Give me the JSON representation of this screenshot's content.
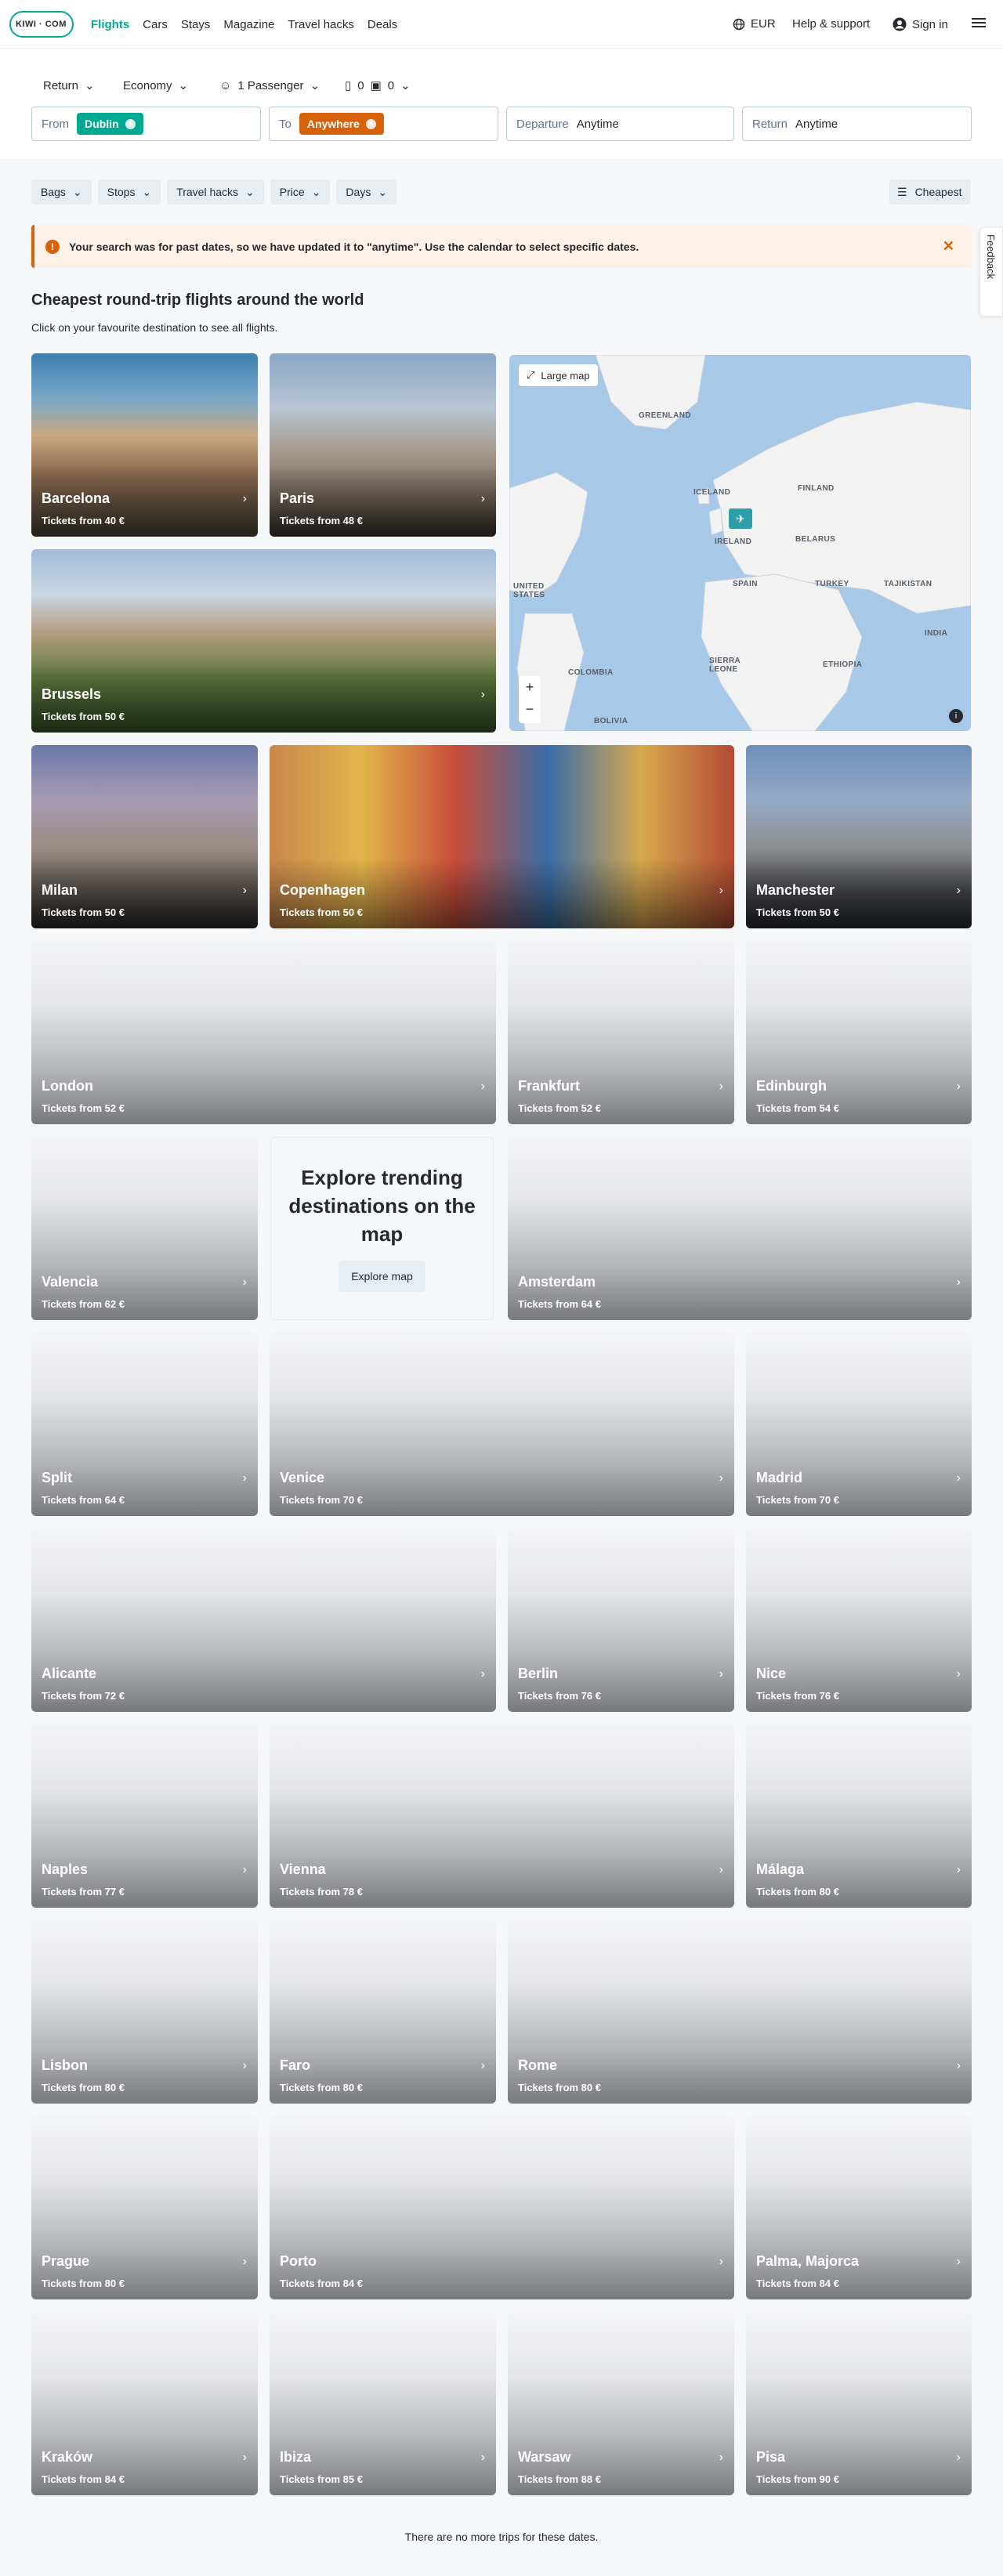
{
  "header": {
    "logo": "KIWI · COM",
    "nav": [
      "Flights",
      "Cars",
      "Stays",
      "Magazine",
      "Travel hacks",
      "Deals"
    ],
    "currency": "EUR",
    "help": "Help & support",
    "signin": "Sign in"
  },
  "search": {
    "trip_type": "Return",
    "cabin": "Economy",
    "passengers": "1 Passenger",
    "cabin_bags": "0",
    "checked_bags": "0",
    "from_label": "From",
    "from_value": "Dublin",
    "to_label": "To",
    "to_value": "Anywhere",
    "departure_label": "Departure",
    "departure_value": "Anytime",
    "return_label": "Return",
    "return_value": "Anytime"
  },
  "filters": [
    "Bags",
    "Stops",
    "Travel hacks",
    "Price",
    "Days"
  ],
  "sort": "Cheapest",
  "alert": "Your search was for past dates, so we have updated it to \"anytime\". Use the calendar to select specific dates.",
  "feedback": "Feedback",
  "page": {
    "title": "Cheapest round-trip flights around the world",
    "subtitle": "Click on your favourite destination to see all flights."
  },
  "map": {
    "button": "Large map",
    "labels": [
      "GREENLAND",
      "ICELAND",
      "FINLAND",
      "IRELAND",
      "BELARUS",
      "UNITED STATES",
      "SPAIN",
      "TURKEY",
      "TAJIKISTAN",
      "INDIA",
      "COLOMBIA",
      "SIERRA LEONE",
      "ETHIOPIA",
      "BOLIVIA"
    ]
  },
  "trending": {
    "title": "Explore trending destinations on the map",
    "button": "Explore map"
  },
  "destinations": [
    {
      "name": "Barcelona",
      "price": "Tickets from 40 €"
    },
    {
      "name": "Paris",
      "price": "Tickets from 48 €"
    },
    {
      "name": "Brussels",
      "price": "Tickets from 50 €"
    },
    {
      "name": "Milan",
      "price": "Tickets from 50 €"
    },
    {
      "name": "Copenhagen",
      "price": "Tickets from 50 €"
    },
    {
      "name": "Manchester",
      "price": "Tickets from 50 €"
    },
    {
      "name": "London",
      "price": "Tickets from 52 €"
    },
    {
      "name": "Frankfurt",
      "price": "Tickets from 52 €"
    },
    {
      "name": "Edinburgh",
      "price": "Tickets from 54 €"
    },
    {
      "name": "Valencia",
      "price": "Tickets from 62 €"
    },
    {
      "name": "Amsterdam",
      "price": "Tickets from 64 €"
    },
    {
      "name": "Split",
      "price": "Tickets from 64 €"
    },
    {
      "name": "Venice",
      "price": "Tickets from 70 €"
    },
    {
      "name": "Madrid",
      "price": "Tickets from 70 €"
    },
    {
      "name": "Alicante",
      "price": "Tickets from 72 €"
    },
    {
      "name": "Berlin",
      "price": "Tickets from 76 €"
    },
    {
      "name": "Nice",
      "price": "Tickets from 76 €"
    },
    {
      "name": "Naples",
      "price": "Tickets from 77 €"
    },
    {
      "name": "Vienna",
      "price": "Tickets from 78 €"
    },
    {
      "name": "Málaga",
      "price": "Tickets from 80 €"
    },
    {
      "name": "Lisbon",
      "price": "Tickets from 80 €"
    },
    {
      "name": "Faro",
      "price": "Tickets from 80 €"
    },
    {
      "name": "Rome",
      "price": "Tickets from 80 €"
    },
    {
      "name": "Prague",
      "price": "Tickets from 80 €"
    },
    {
      "name": "Porto",
      "price": "Tickets from 84 €"
    },
    {
      "name": "Palma, Majorca",
      "price": "Tickets from 84 €"
    },
    {
      "name": "Kraków",
      "price": "Tickets from 84 €"
    },
    {
      "name": "Ibiza",
      "price": "Tickets from 85 €"
    },
    {
      "name": "Warsaw",
      "price": "Tickets from 88 €"
    },
    {
      "name": "Pisa",
      "price": "Tickets from 90 €"
    }
  ],
  "footer_note": "There are no more trips for these dates.",
  "colors": {
    "brand": "#00a991",
    "accent": "#d7610a"
  }
}
